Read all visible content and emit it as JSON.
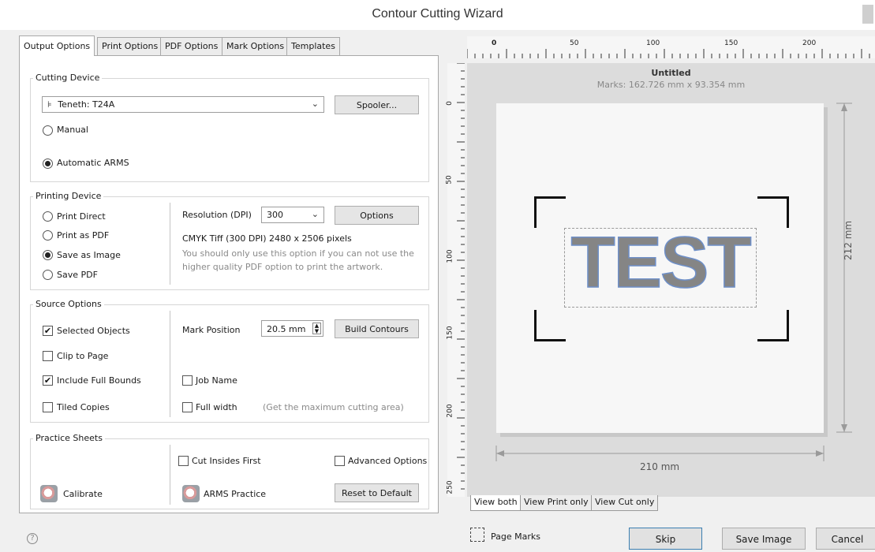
{
  "window": {
    "title": "Contour Cutting Wizard"
  },
  "tabs": [
    {
      "label": "Output Options",
      "active": true
    },
    {
      "label": "Print Options"
    },
    {
      "label": "PDF Options"
    },
    {
      "label": "Mark Options"
    },
    {
      "label": "Templates"
    }
  ],
  "cutting_device": {
    "group_label": "Cutting Device",
    "device_value": "Teneth: T24A",
    "spooler_button": "Spooler...",
    "radio_manual": "Manual",
    "radio_automatic": "Automatic ARMS",
    "selected": "Automatic ARMS"
  },
  "printing_device": {
    "group_label": "Printing Device",
    "options": [
      "Print Direct",
      "Print as PDF",
      "Save as Image",
      "Save PDF"
    ],
    "selected": "Save as Image",
    "resolution_label": "Resolution (DPI)",
    "resolution_value": "300",
    "options_button": "Options",
    "info": "CMYK Tiff  (300 DPI) 2480 x 2506 pixels",
    "note_line1": "You should only use this option if you can not use the",
    "note_line2": "higher quality PDF option to print the artwork."
  },
  "source_options": {
    "group_label": "Source Options",
    "selected_objects": "Selected Objects",
    "clip_to_page": "Clip to Page",
    "include_full_bounds": "Include Full Bounds",
    "tiled_copies": "Tiled Copies",
    "mark_position_label": "Mark Position",
    "mark_position_value": "20.5 mm",
    "build_contours_button": "Build Contours",
    "job_name": "Job Name",
    "full_width": "Full width",
    "full_width_note": "(Get the maximum cutting area)"
  },
  "practice_sheets": {
    "group_label": "Practice Sheets",
    "cut_insides_first": "Cut Insides First",
    "advanced_options": "Advanced Options",
    "calibrate": "Calibrate",
    "arms_practice": "ARMS Practice",
    "reset_button": "Reset to Default"
  },
  "preview": {
    "doc_title": "Untitled",
    "marks_info": "Marks: 162.726 mm x 93.354 mm",
    "artwork_text": "TEST",
    "width_label": "210 mm",
    "height_label": "212 mm",
    "hruler_labels": [
      "0",
      "50",
      "100",
      "150",
      "200"
    ],
    "vruler_labels": [
      "0",
      "50",
      "100",
      "150",
      "200",
      "250"
    ],
    "view_tabs": [
      "View both",
      "View Print only",
      "View Cut only"
    ],
    "page_marks_label": "Page Marks"
  },
  "footer": {
    "help_icon": "?",
    "skip_button": "Skip",
    "save_image_button": "Save Image",
    "cancel_button": "Cancel"
  }
}
